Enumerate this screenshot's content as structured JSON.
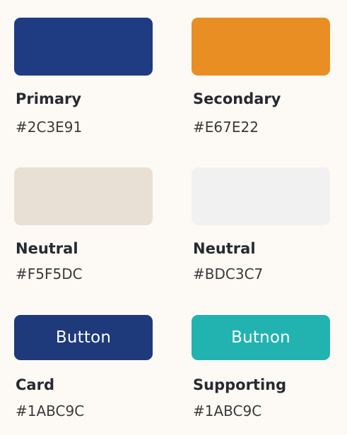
{
  "swatches": [
    {
      "name": "Primary",
      "hex": "#2C3E91",
      "color": "#1f3b82"
    },
    {
      "name": "Secondary",
      "hex": "#E67E22",
      "color": "#e98e22"
    },
    {
      "name": "Neutral",
      "hex": "#F5F5DC",
      "color": "#e8e0d4"
    },
    {
      "name": "Neutral",
      "hex": "#BDC3C7",
      "color": "#f1f1f1"
    },
    {
      "name": "Card",
      "hex": "#1ABC9C",
      "color": "#1e3a7b",
      "button_label": "Button"
    },
    {
      "name": "Supporting",
      "hex": "#1ABC9C",
      "color": "#22b3b1",
      "button_label": "Butnon"
    }
  ]
}
